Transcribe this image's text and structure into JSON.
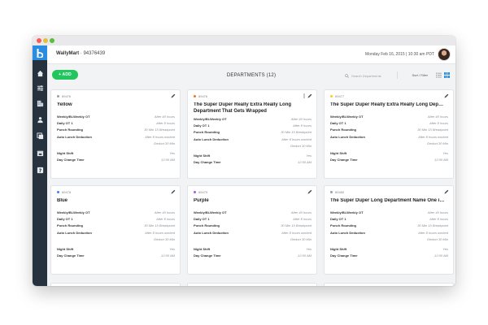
{
  "topbar": {
    "company_name": "WallyMart",
    "company_id": "94376439",
    "datetime": "Monday Feb 16, 2015 | 10:30 am PDT"
  },
  "toolbar": {
    "add_label": "+ ADD",
    "page_title": "DEPARTMENTS (12)",
    "search_placeholder": "Search Departments",
    "sort_label": "Sort / Filter"
  },
  "labels": {
    "weekly_ot": "Weekly/Bi-Weekly OT",
    "daily_ot": "Daily OT 1",
    "punch_rounding": "Punch Rounding",
    "auto_lunch": "Auto Lunch Deduction",
    "night_shift": "Night Shift",
    "day_change": "Day Change Time"
  },
  "cards": [
    {
      "id": "89476",
      "dot_color": "#9aa0a6",
      "title": "Yellow",
      "weekly_ot": "After 40 hours",
      "daily_ot": "After 8 hours",
      "punch_rounding": "30 Min 15 Breakpoint",
      "auto_lunch_1": "After 8 hours worked",
      "auto_lunch_2": "Deduct 30 Min",
      "night_shift": "Yes",
      "day_change": "12:00 AM"
    },
    {
      "id": "89476",
      "dot_color": "#f97316",
      "title": "The Super Duper Really Extra Really Long Department That Gets Wrapped",
      "weekly_ot": "After 40 hours",
      "daily_ot": "After 8 hours",
      "punch_rounding": "30 Min 15 Breakpoint",
      "auto_lunch_1": "After 8 hours worked",
      "auto_lunch_2": "Deduct 30 Min",
      "night_shift": "Yes",
      "day_change": "12:00 AM"
    },
    {
      "id": "89477",
      "dot_color": "#facc15",
      "title": "The Super Duper Really Extra Really Long Depart...",
      "weekly_ot": "After 40 hours",
      "daily_ot": "After 8 hours",
      "punch_rounding": "30 Min 15 Breakpoint",
      "auto_lunch_1": "After 8 hours worked",
      "auto_lunch_2": "Deduct 30 Min",
      "night_shift": "Yes",
      "day_change": "12:00 AM"
    },
    {
      "id": "89478",
      "dot_color": "#3b82f6",
      "title": "Blue",
      "weekly_ot": "After 40 hours",
      "daily_ot": "After 8 hours",
      "punch_rounding": "30 Min 15 Breakpoint",
      "auto_lunch_1": "After 8 hours worked",
      "auto_lunch_2": "Deduct 30 Min",
      "night_shift": "Yes",
      "day_change": "12:00 AM"
    },
    {
      "id": "89479",
      "dot_color": "#a855f7",
      "title": "Purple",
      "weekly_ot": "After 40 hours",
      "daily_ot": "After 8 hours",
      "punch_rounding": "30 Min 15 Breakpoint",
      "auto_lunch_1": "After 8 hours worked",
      "auto_lunch_2": "Deduct 30 Min",
      "night_shift": "Yes",
      "day_change": "12:00 AM"
    },
    {
      "id": "89480",
      "dot_color": "#9aa0a6",
      "title": "The Super Duper Long Department Name One is L...",
      "weekly_ot": "After 40 hours",
      "daily_ot": "After 8 hours",
      "punch_rounding": "30 Min 15 Breakpoint",
      "auto_lunch_1": "After 8 hours worked",
      "auto_lunch_2": "Deduct 30 Min",
      "night_shift": "Yes",
      "day_change": "12:00 AM"
    }
  ],
  "colors": {
    "accent_green": "#22c55e",
    "sidebar": "#26333f",
    "logo_blue": "#2a8de0",
    "grid_view_active": "#2a8de0"
  },
  "icons": {
    "sidebar": [
      "home-icon",
      "sliders-icon",
      "building-icon",
      "people-icon",
      "copy-icon",
      "calendar-icon",
      "help-icon"
    ]
  }
}
